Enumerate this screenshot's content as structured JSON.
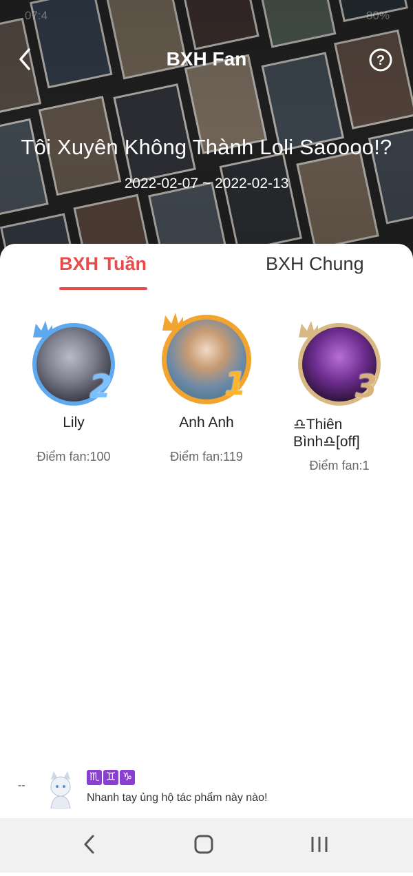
{
  "statusbar": {
    "time": "07:4",
    "battery": "80%"
  },
  "header": {
    "title": "BXH Fan",
    "work_title": "Tôi Xuyên Không Thành Loli Saoooo!?",
    "date_range": "2022-02-07 ~ 2022-02-13"
  },
  "tabs": [
    {
      "label": "BXH Tuần",
      "active": true
    },
    {
      "label": "BXH Chung",
      "active": false
    }
  ],
  "ranking": [
    {
      "rank": "2",
      "name": "Lily",
      "score": "Điểm fan:100",
      "ring_color": "#5ea8ee"
    },
    {
      "rank": "1",
      "name": "Anh Anh",
      "score": "Điểm fan:119",
      "ring_color": "#f2a42e"
    },
    {
      "rank": "3",
      "name": "♎Thiên Bình♎[off]",
      "score": "Điểm fan:1",
      "ring_color": "#d9b983"
    }
  ],
  "banner": {
    "dash": "--",
    "badges": [
      "♏",
      "♊",
      "♑"
    ],
    "text": "Nhanh tay ủng hộ tác phẩm này nào!"
  },
  "accent": "#ea4a4a"
}
